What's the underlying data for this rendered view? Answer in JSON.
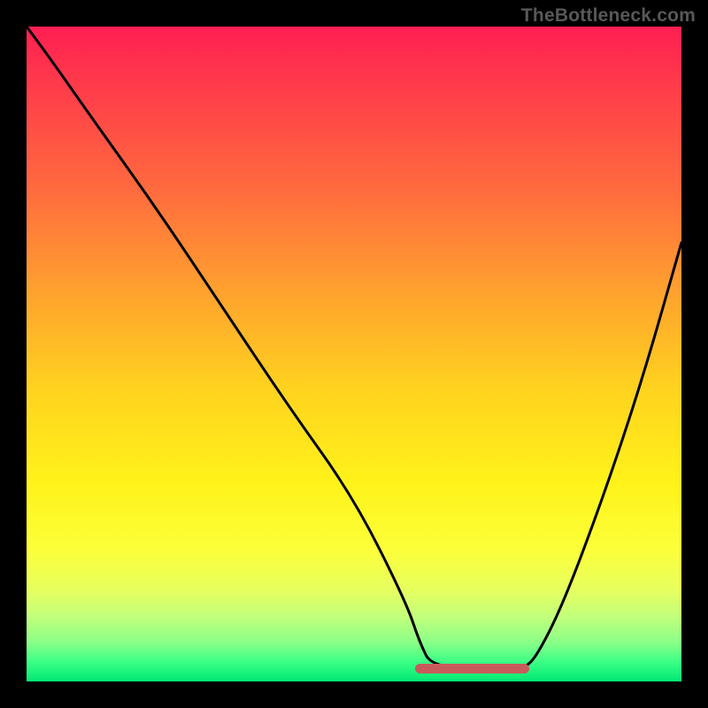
{
  "watermark": {
    "text": "TheBottleneck.com"
  },
  "colors": {
    "background": "#000000",
    "curve": "#000000",
    "plateau": "#c95a5c",
    "watermark": "#585858"
  },
  "chart_data": {
    "type": "line",
    "title": "",
    "xlabel": "",
    "ylabel": "",
    "xlim": [
      0,
      100
    ],
    "ylim": [
      0,
      100
    ],
    "grid": false,
    "legend": false,
    "series": [
      {
        "name": "curve",
        "x": [
          0,
          3,
          10,
          20,
          30,
          40,
          50,
          58,
          60,
          62,
          74,
          76,
          78,
          82,
          88,
          94,
          100
        ],
        "y": [
          100,
          96,
          86,
          72,
          57,
          42,
          28,
          12,
          6,
          2,
          2,
          2,
          4,
          12,
          28,
          46,
          67
        ]
      }
    ],
    "annotations": [
      {
        "name": "plateau-highlight",
        "x_start": 60,
        "x_end": 76,
        "y": 2,
        "color": "#c95a5c"
      }
    ]
  }
}
